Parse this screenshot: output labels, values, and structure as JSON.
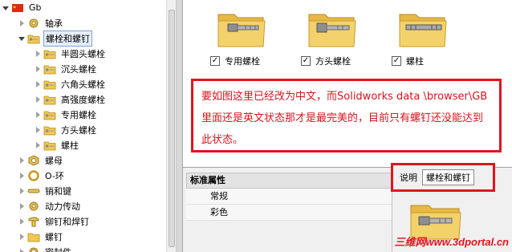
{
  "tree": {
    "root": {
      "label": "Gb",
      "icon": "china-flag-icon"
    },
    "items": [
      {
        "label": "轴承",
        "icon": "gear-icon",
        "expanded": false
      },
      {
        "label": "螺栓和螺钉",
        "icon": "folder-bolt-icon",
        "expanded": true,
        "selected": true
      },
      {
        "label": "半圆头螺栓",
        "icon": "folder-bolt-icon",
        "child": true
      },
      {
        "label": "沉头螺栓",
        "icon": "folder-bolt-icon",
        "child": true
      },
      {
        "label": "六角头螺栓",
        "icon": "folder-bolt-icon",
        "child": true
      },
      {
        "label": "高强度螺栓",
        "icon": "folder-bolt-icon",
        "child": true
      },
      {
        "label": "专用螺栓",
        "icon": "folder-bolt-icon",
        "child": true
      },
      {
        "label": "方头螺栓",
        "icon": "folder-bolt-icon",
        "child": true
      },
      {
        "label": "螺柱",
        "icon": "folder-bolt-icon",
        "child": true
      },
      {
        "label": "螺母",
        "icon": "nut-icon",
        "expanded": false
      },
      {
        "label": "O-环",
        "icon": "o-ring-icon",
        "expanded": false
      },
      {
        "label": "销和键",
        "icon": "pin-icon",
        "expanded": false
      },
      {
        "label": "动力传动",
        "icon": "gear-icon",
        "expanded": false
      },
      {
        "label": "铆钉和焊钉",
        "icon": "rivet-icon",
        "expanded": false
      },
      {
        "label": "螺钉",
        "icon": "folder-icon",
        "expanded": false
      },
      {
        "label": "密封件",
        "icon": "seal-icon",
        "expanded": false
      }
    ]
  },
  "tiles": [
    {
      "label": "专用螺栓",
      "checked": true,
      "icon": "folder-bolt-icon"
    },
    {
      "label": "方头螺栓",
      "checked": true,
      "icon": "folder-bolt-icon"
    },
    {
      "label": "螺柱",
      "checked": true,
      "icon": "folder-stud-icon"
    }
  ],
  "note": {
    "text": "要如图这里已经改为中文，而Solidworks data \\browser\\GB里面还是英文状态那才是最完美的，目前只有螺钉还没能达到此状态。"
  },
  "properties": {
    "header": "标准属性",
    "rows": [
      "常规",
      "彩色"
    ]
  },
  "description": {
    "label": "说明",
    "value": "螺栓和螺钉"
  },
  "watermark": "三维网www.3dportal.cn",
  "colors": {
    "annotation_red": "#e0141e",
    "folder_yellow": "#f4d26b",
    "selection_blue": "#7da2ce"
  }
}
